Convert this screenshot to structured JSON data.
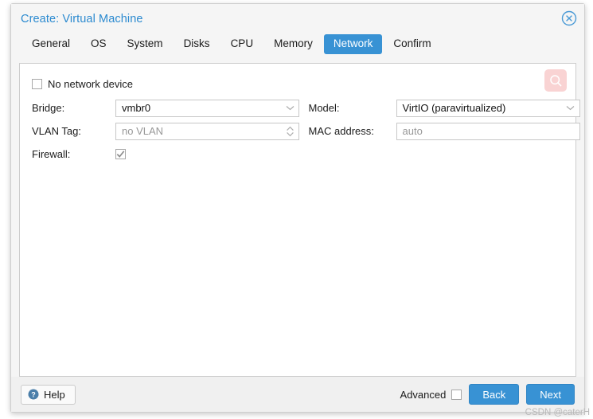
{
  "window": {
    "title": "Create: Virtual Machine",
    "close_icon": "close-circle-icon"
  },
  "tabs": [
    {
      "label": "General",
      "active": false
    },
    {
      "label": "OS",
      "active": false
    },
    {
      "label": "System",
      "active": false
    },
    {
      "label": "Disks",
      "active": false
    },
    {
      "label": "CPU",
      "active": false
    },
    {
      "label": "Memory",
      "active": false
    },
    {
      "label": "Network",
      "active": true
    },
    {
      "label": "Confirm",
      "active": false
    }
  ],
  "form": {
    "no_network_device": {
      "label": "No network device",
      "checked": false
    },
    "left": [
      {
        "label": "Bridge:",
        "value": "vmbr0",
        "placeholder": "",
        "type": "combobox",
        "is_placeholder": false
      },
      {
        "label": "VLAN Tag:",
        "value": "no VLAN",
        "placeholder": "no VLAN",
        "type": "spinner",
        "is_placeholder": true
      }
    ],
    "firewall": {
      "label": "Firewall:",
      "checked": true
    },
    "right": [
      {
        "label": "Model:",
        "value": "VirtIO (paravirtualized)",
        "placeholder": "",
        "type": "combobox",
        "is_placeholder": false
      },
      {
        "label": "MAC address:",
        "value": "auto",
        "placeholder": "auto",
        "type": "text",
        "is_placeholder": true
      }
    ],
    "search_button": {
      "icon": "search-icon"
    }
  },
  "footer": {
    "help_label": "Help",
    "help_icon": "question-circle-icon",
    "advanced_label": "Advanced",
    "advanced_checked": false,
    "back_label": "Back",
    "next_label": "Next"
  },
  "watermark": "CSDN @caterH",
  "colors": {
    "accent": "#3892d4",
    "title": "#2b8ad0",
    "panel_bg": "#f5f5f5",
    "footer_bg": "#f0f0f0",
    "search_btn_bg": "#f9d3d3",
    "field_border": "#c7c7c7"
  }
}
